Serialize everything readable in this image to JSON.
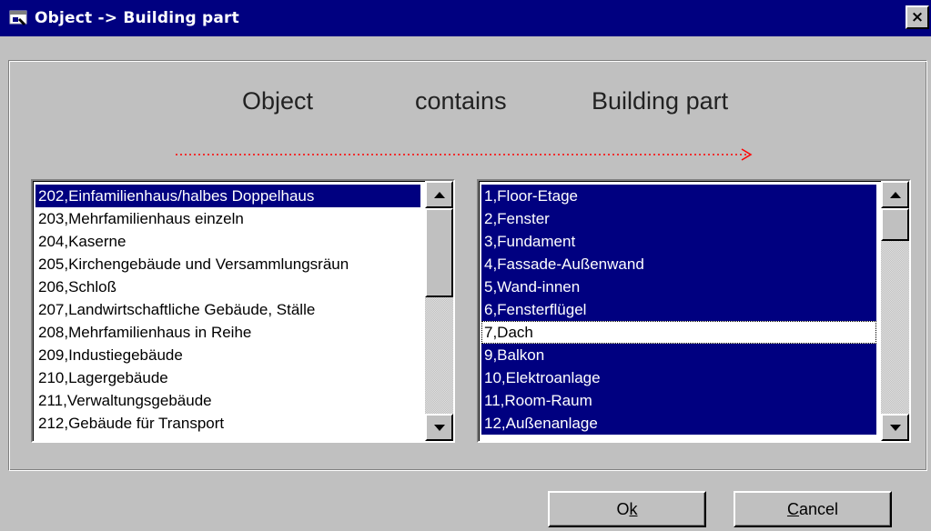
{
  "window": {
    "title": "Object -> Building part",
    "close_label": "×"
  },
  "header": {
    "object": "Object",
    "contains": "contains",
    "building_part": "Building part"
  },
  "objects_list": {
    "items": [
      "202,Einfamilienhaus/halbes Doppelhaus",
      "203,Mehrfamilienhaus einzeln",
      "204,Kaserne",
      "205,Kirchengebäude und Versammlungsräun",
      "206,Schloß",
      "207,Landwirtschaftliche Gebäude, Ställe",
      "208,Mehrfamilienhaus in Reihe",
      "209,Industiegebäude",
      "210,Lagergebäude",
      "211,Verwaltungsgebäude",
      "212,Gebäude für Transport"
    ],
    "selected_index": 0
  },
  "building_parts_list": {
    "items": [
      "1,Floor-Etage",
      "2,Fenster",
      "3,Fundament",
      "4,Fassade-Außenwand",
      "5,Wand-innen",
      "6,Fensterflügel",
      "7,Dach",
      "9,Balkon",
      "10,Elektroanlage",
      "11,Room-Raum",
      "12,Außenanlage"
    ],
    "focused_unselected_index": 6
  },
  "buttons": {
    "ok_pre": "O",
    "ok_mnemonic": "k",
    "cancel_mnemonic": "C",
    "cancel_post": "ancel"
  },
  "colors": {
    "title_bar": "#000080",
    "selection": "#000080",
    "arrow": "#ff0000",
    "face": "#c0c0c0"
  },
  "icons": {
    "title": "app-window-icon",
    "close": "close-icon",
    "scroll_up": "scroll-up-arrow-icon",
    "scroll_down": "scroll-down-arrow-icon",
    "arrow": "dotted-right-arrow-icon"
  }
}
